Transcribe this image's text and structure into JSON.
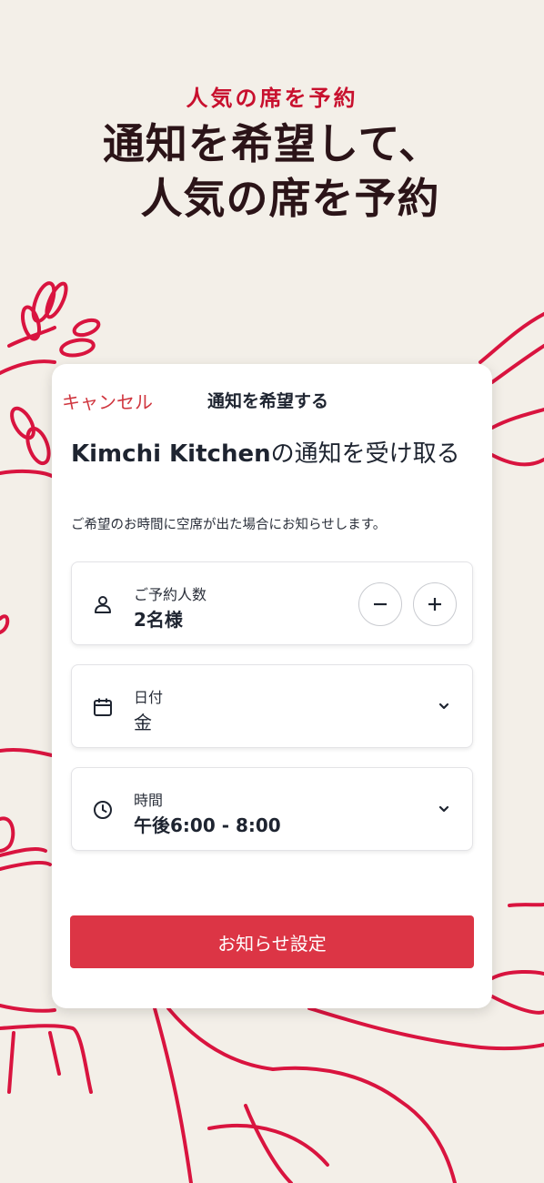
{
  "promo": {
    "subtitle": "人気の席を予約",
    "title_line1": "通知を希望して、",
    "title_line2": "人気の席を予約"
  },
  "sheet": {
    "cancel_label": "キャンセル",
    "title": "通知を希望する",
    "restaurant_name": "Kimchi Kitchen",
    "heading_suffix": "の通知を受け取る",
    "description": "ご希望のお時間に空席が出た場合にお知らせします。"
  },
  "party": {
    "label": "ご予約人数",
    "value": "2名様",
    "icon": "person-icon",
    "decrement_icon": "minus-icon",
    "increment_icon": "plus-icon"
  },
  "date": {
    "label": "日付",
    "value": "金",
    "icon": "calendar-icon"
  },
  "time": {
    "label": "時間",
    "value": "午後6:00 - 8:00",
    "icon": "clock-icon"
  },
  "submit_label": "お知らせ設定",
  "colors": {
    "accent_red": "#dc3545",
    "brand_red": "#c8102e",
    "background": "#f3efe8",
    "title_dark": "#2b1418"
  }
}
